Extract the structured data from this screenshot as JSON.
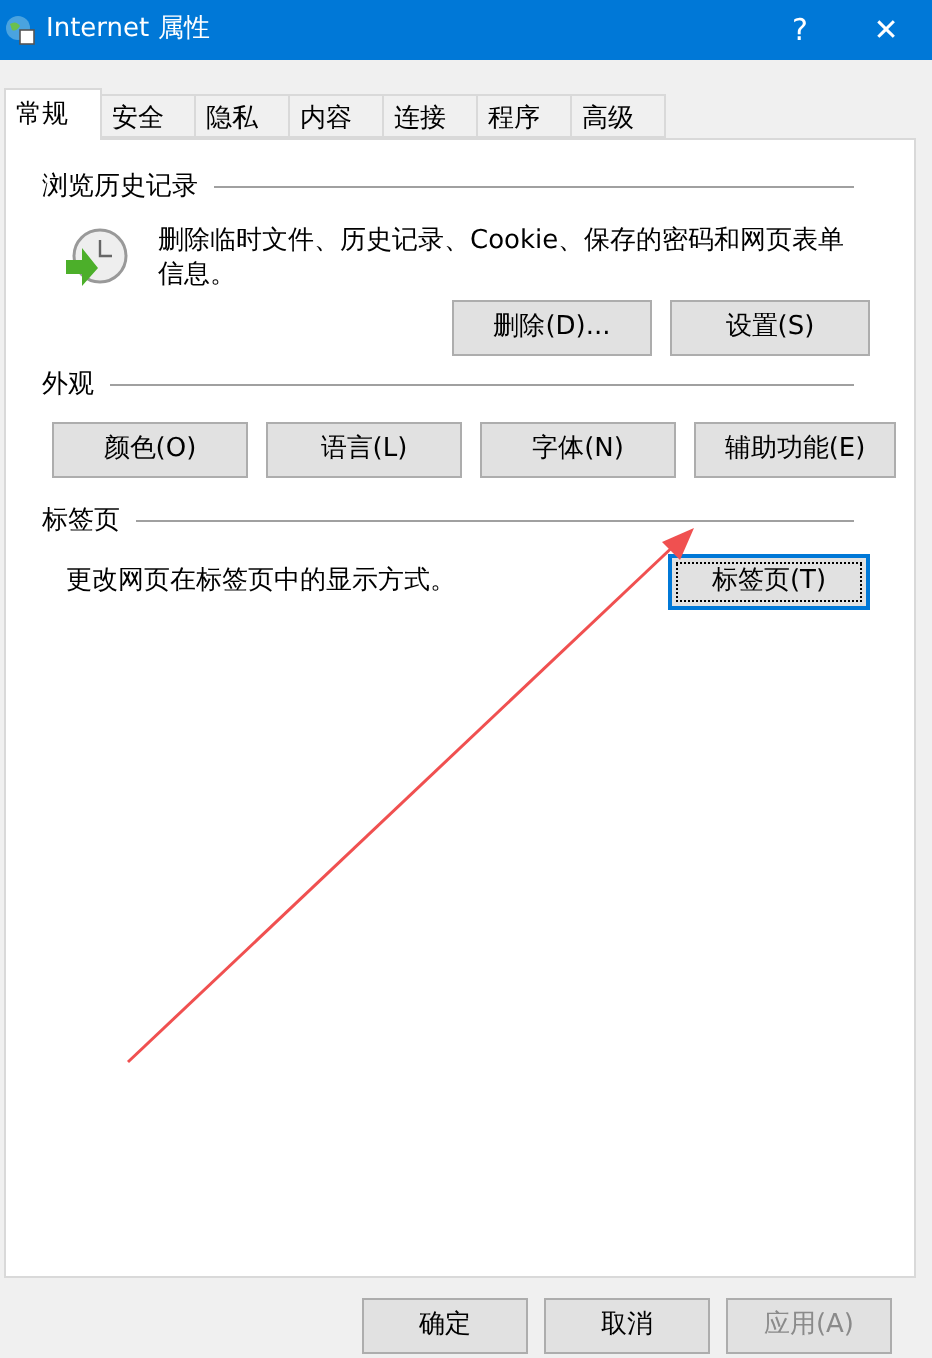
{
  "window": {
    "title": "Internet 属性",
    "help": "?",
    "close": "✕"
  },
  "tabs": [
    {
      "label": "常规",
      "selected": true
    },
    {
      "label": "安全",
      "selected": false
    },
    {
      "label": "隐私",
      "selected": false
    },
    {
      "label": "内容",
      "selected": false
    },
    {
      "label": "连接",
      "selected": false
    },
    {
      "label": "程序",
      "selected": false
    },
    {
      "label": "高级",
      "selected": false
    }
  ],
  "history": {
    "heading": "浏览历史记录",
    "description": "删除临时文件、历史记录、Cookie、保存的密码和网页表单信息。",
    "buttons": [
      {
        "label": "删除(D)...",
        "focused": false
      },
      {
        "label": "设置(S)",
        "focused": false
      }
    ]
  },
  "appearance": {
    "heading": "外观",
    "buttons": [
      {
        "label": "颜色(O)",
        "focused": false
      },
      {
        "label": "语言(L)",
        "focused": false
      },
      {
        "label": "字体(N)",
        "focused": false
      },
      {
        "label": "辅助功能(E)",
        "focused": false
      }
    ]
  },
  "tabbed": {
    "heading": "标签页",
    "description": "更改网页在标签页中的显示方式。",
    "button": {
      "label": "标签页(T)",
      "focused": true
    }
  },
  "footer_buttons": [
    {
      "label": "确定",
      "disabled": false
    },
    {
      "label": "取消",
      "disabled": false
    },
    {
      "label": "应用(A)",
      "disabled": true
    }
  ]
}
